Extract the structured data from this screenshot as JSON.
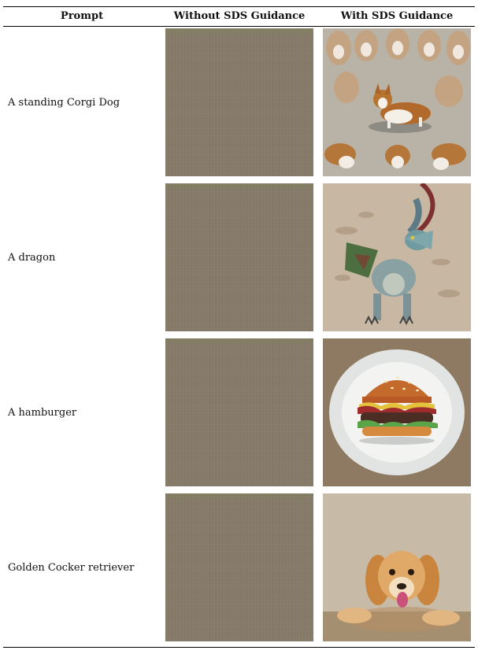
{
  "table": {
    "headers": {
      "prompt": "Prompt",
      "without": "Without SDS Guidance",
      "with": "With SDS Guidance"
    },
    "rows": [
      {
        "prompt": "A standing Corgi Dog",
        "with_image": "corgi-image"
      },
      {
        "prompt": "A dragon",
        "with_image": "dragon-image"
      },
      {
        "prompt": "A hamburger",
        "with_image": "hamburger-image"
      },
      {
        "prompt": "Golden Cocker retriever",
        "with_image": "cocker-image"
      }
    ]
  },
  "colors": {
    "without_fill": "#867a68",
    "rule": "#000000"
  }
}
